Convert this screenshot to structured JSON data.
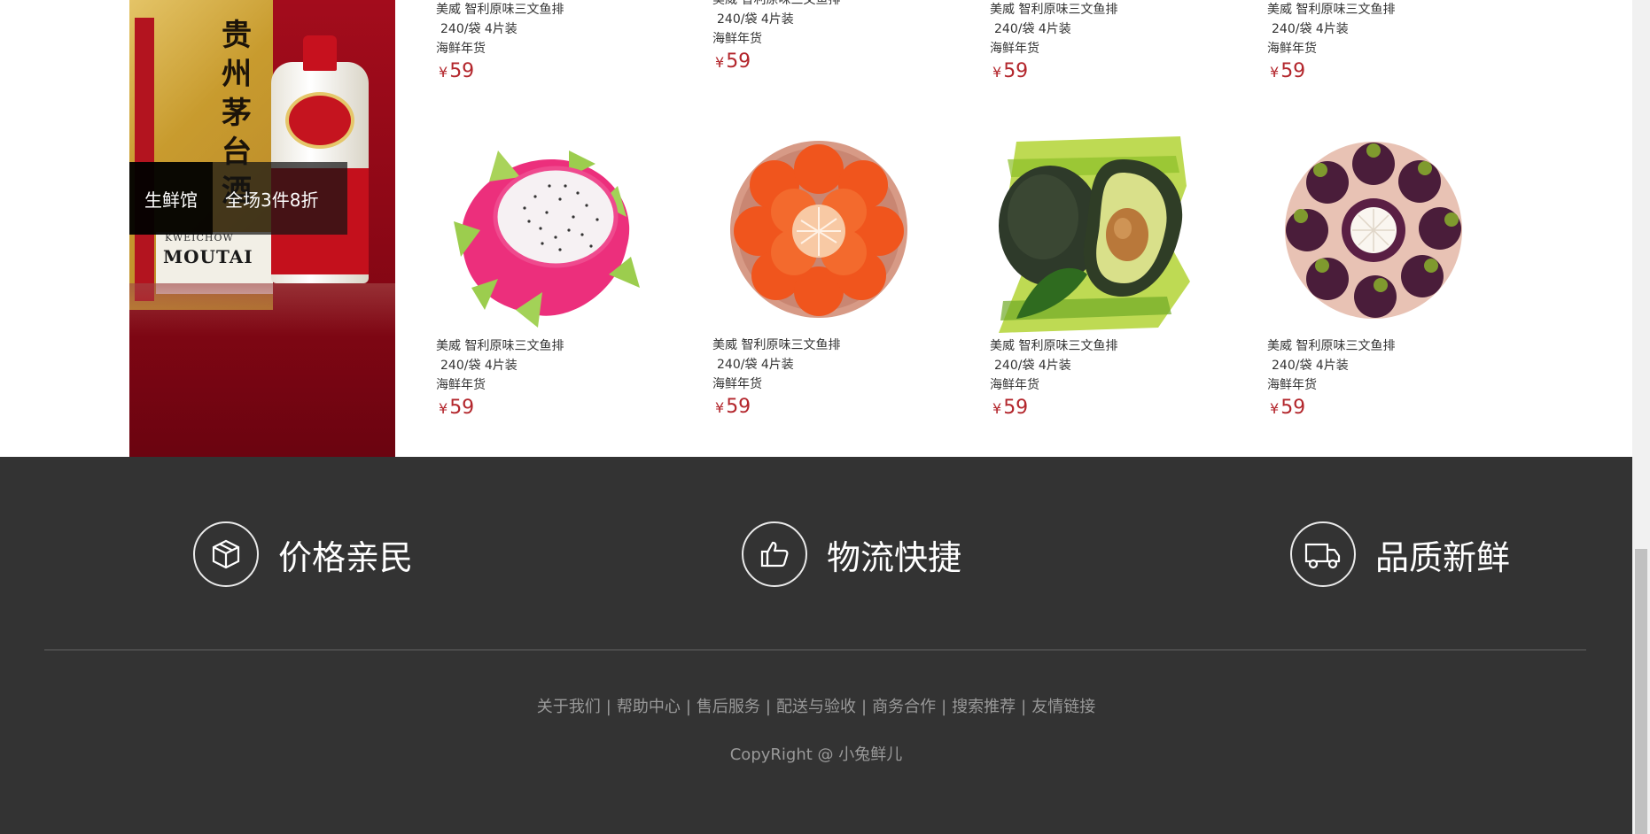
{
  "banner": {
    "tag_left": "生鲜馆",
    "tag_right": "全场3件8折",
    "box_title": "贵州茅台酒",
    "brand": "MOUTAI",
    "brand_sub": "KWEICHOW"
  },
  "currency_symbol": "¥",
  "products_top": [
    {
      "name": "美威 智利原味三文鱼排",
      "spec": "240/袋 4片装",
      "category": "海鲜年货",
      "price": "59"
    },
    {
      "name": "美威 智利原味三文鱼排",
      "spec": "240/袋 4片装",
      "category": "海鲜年货",
      "price": "59"
    },
    {
      "name": "美威 智利原味三文鱼排",
      "spec": "240/袋 4片装",
      "category": "海鲜年货",
      "price": "59"
    },
    {
      "name": "美威 智利原味三文鱼排",
      "spec": "240/袋 4片装",
      "category": "海鲜年货",
      "price": "59"
    }
  ],
  "products_bottom": [
    {
      "name": "美威 智利原味三文鱼排",
      "spec": "240/袋 4片装",
      "category": "海鲜年货",
      "price": "59",
      "image": "dragon-fruit"
    },
    {
      "name": "美威 智利原味三文鱼排",
      "spec": "240/袋 4片装",
      "category": "海鲜年货",
      "price": "59",
      "image": "mandarin-oranges"
    },
    {
      "name": "美威 智利原味三文鱼排",
      "spec": "240/袋 4片装",
      "category": "海鲜年货",
      "price": "59",
      "image": "avocado"
    },
    {
      "name": "美威 智利原味三文鱼排",
      "spec": "240/袋 4片装",
      "category": "海鲜年货",
      "price": "59",
      "image": "mangosteen"
    }
  ],
  "footer": {
    "promises": [
      {
        "label": "价格亲民",
        "icon": "box-icon"
      },
      {
        "label": "物流快捷",
        "icon": "thumbs-up-icon"
      },
      {
        "label": "品质新鲜",
        "icon": "truck-icon"
      }
    ],
    "links": [
      "关于我们",
      "帮助中心",
      "售后服务",
      "配送与验收",
      "商务合作",
      "搜索推荐",
      "友情链接"
    ],
    "link_separator": "|",
    "copyright": "CopyRight @ 小兔鲜儿"
  },
  "colors": {
    "footer_bg": "#333333",
    "price": "#b3262c",
    "link_text": "#999999"
  }
}
